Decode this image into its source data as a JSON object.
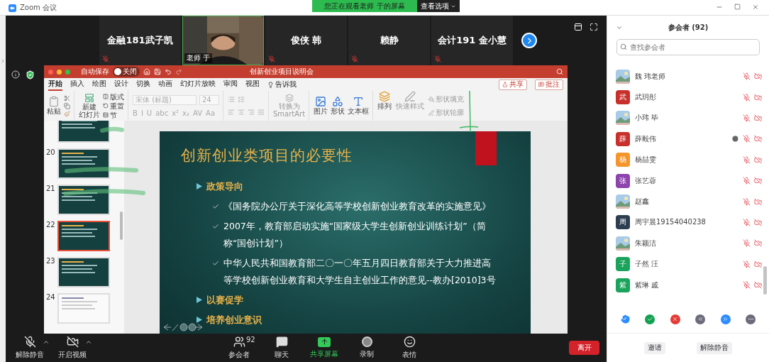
{
  "window": {
    "title": "Zoom 会议"
  },
  "share_banner": {
    "text": "您正在观看老师 于的屏幕",
    "options": "查看选项"
  },
  "video_strip": {
    "tiles": [
      {
        "kind": "name",
        "name": "金融181武子凯"
      },
      {
        "kind": "video",
        "name": "老师 于"
      },
      {
        "kind": "name",
        "name": "俊侠 韩"
      },
      {
        "kind": "name",
        "name": "赖静"
      },
      {
        "kind": "name",
        "name": "会计191 金小慧"
      }
    ]
  },
  "presentation": {
    "autosave_label": "自动保存",
    "autosave_on": false,
    "autosave_state": "关闭",
    "title": "创新创业项目说明会",
    "tabs": [
      {
        "label": "开始",
        "selected": true
      },
      {
        "label": "插入",
        "selected": false
      },
      {
        "label": "绘图",
        "selected": false
      },
      {
        "label": "设计",
        "selected": false
      },
      {
        "label": "切换",
        "selected": false
      },
      {
        "label": "动画",
        "selected": false
      },
      {
        "label": "幻灯片放映",
        "selected": false
      },
      {
        "label": "审阅",
        "selected": false
      },
      {
        "label": "视图",
        "selected": false
      }
    ],
    "tell_me": "告诉我",
    "share_button": "共享",
    "comment_button": "批注",
    "ribbon": {
      "paste": "粘贴",
      "new_slide": [
        "新建",
        "幻灯片"
      ],
      "layout": "版式",
      "reset": "重置",
      "section": "节",
      "font": "宋体 (标题)",
      "font_size": "24",
      "format_buttons": [
        "B",
        "I",
        "U",
        "abc",
        "x²",
        "x₂",
        "AV",
        "Aa"
      ],
      "smartart": [
        "转换为",
        "SmartArt"
      ],
      "picture": "图片",
      "shape": "形状",
      "textbox": "文本框",
      "arrange": "排列",
      "quick_styles": "快速样式",
      "shape_fill": "形状填充",
      "shape_outline": "形状轮廓"
    },
    "thumbnails": [
      {
        "kind": "dark",
        "selected": false
      },
      {
        "number": "20",
        "kind": "dark",
        "selected": false
      },
      {
        "number": "21",
        "kind": "dark",
        "selected": false
      },
      {
        "number": "22",
        "kind": "dark",
        "selected": true
      },
      {
        "number": "23",
        "kind": "dark",
        "selected": false
      },
      {
        "number": "24",
        "kind": "light",
        "selected": false
      }
    ],
    "slide": {
      "title": "创新创业类项目的必要性",
      "bullets": [
        {
          "kind": "section",
          "text": "政策导向"
        },
        {
          "kind": "item",
          "text": "《国务院办公厅关于深化高等学校创新创业教育改革的实施意见》"
        },
        {
          "kind": "item",
          "text": "2007年，教育部启动实施“国家级大学生创新创业训练计划”（简称“国创计划”）"
        },
        {
          "kind": "item",
          "text": "中华人民共和国教育部二〇一〇年五月四日教育部关于大力推进高等学校创新创业教育和大学生自主创业工作的意见--教办[2010]3号"
        },
        {
          "kind": "section",
          "text": "以赛促学"
        },
        {
          "kind": "section",
          "text": "培养创业意识"
        }
      ]
    }
  },
  "toolbar": {
    "items": [
      {
        "kind": "mute",
        "label": "解除静音"
      },
      {
        "kind": "video",
        "label": "开启视频"
      },
      {
        "kind": "participants",
        "label": "参会者",
        "count": "92"
      },
      {
        "kind": "chat",
        "label": "聊天"
      },
      {
        "kind": "share",
        "label": "共享屏幕"
      },
      {
        "kind": "record",
        "label": "录制"
      },
      {
        "kind": "reactions",
        "label": "表情"
      }
    ],
    "leave": "离开"
  },
  "participants_panel": {
    "title": "参会者 (92)",
    "search": {
      "placeholder": "查找参会者"
    },
    "participants": [
      {
        "name": "魏 玮老师",
        "waiting": false
      },
      {
        "name": "武玥彤",
        "avatar": {
          "kind": "letter",
          "letter": "武",
          "color": "#c8302c"
        },
        "waiting": false
      },
      {
        "name": "小玮 毕",
        "waiting": false
      },
      {
        "name": "薛毅伟",
        "avatar": {
          "kind": "letter",
          "letter": "薛",
          "color": "#c8302c"
        },
        "waiting": true
      },
      {
        "name": "杨喆雯",
        "avatar": {
          "kind": "letter",
          "letter": "杨",
          "color": "#f5962c"
        },
        "waiting": false
      },
      {
        "name": "张艺蓉",
        "avatar": {
          "kind": "letter",
          "letter": "张",
          "color": "#8e44ad"
        },
        "waiting": false
      },
      {
        "name": "赵鑫",
        "waiting": false
      },
      {
        "name": "周宇晨19154040238",
        "avatar": {
          "kind": "letter",
          "letter": "周",
          "color": "#2c3e50"
        },
        "waiting": false
      },
      {
        "name": "朱颖洁",
        "waiting": false
      },
      {
        "name": "子然 汪",
        "avatar": {
          "kind": "letter",
          "letter": "子",
          "color": "#1aa35a"
        },
        "waiting": false
      },
      {
        "name": "紫琳 戚",
        "avatar": {
          "kind": "letter",
          "letter": "紫",
          "color": "#1aa35a"
        },
        "waiting": false
      }
    ],
    "buttons": [
      "邀请",
      "解除静音"
    ]
  }
}
